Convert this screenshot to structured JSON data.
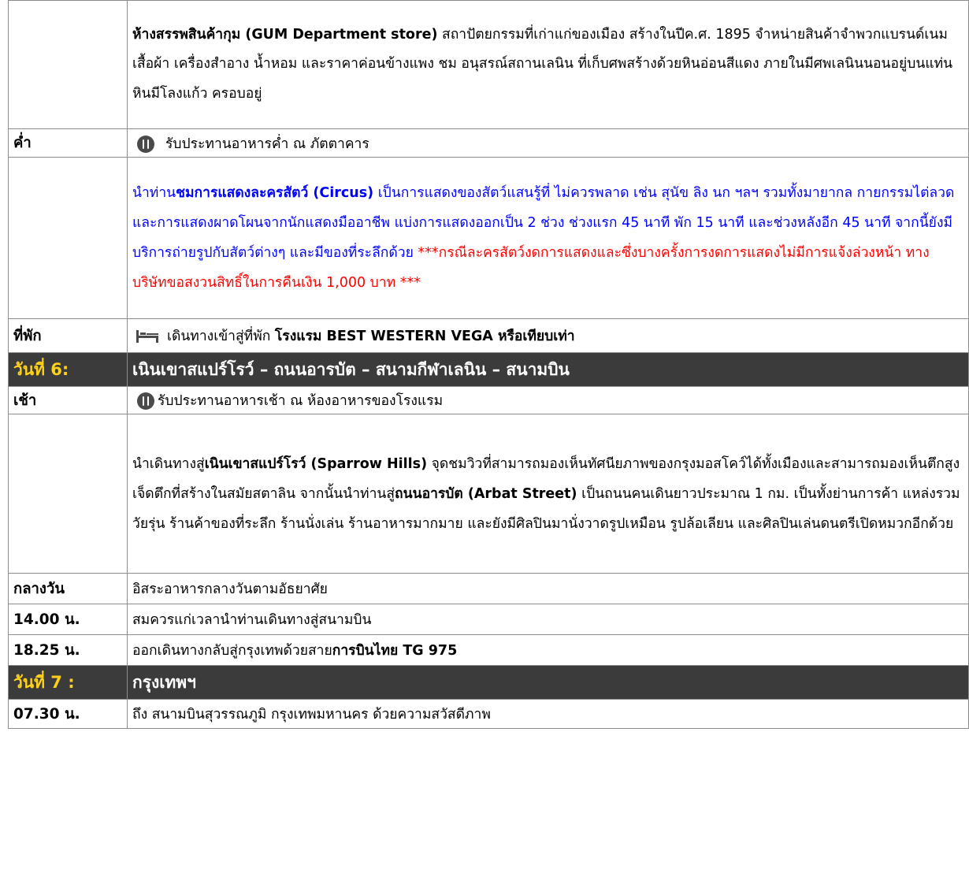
{
  "rows": {
    "gum": {
      "title": "ห้างสรรพสินค้ากุม (GUM Department store)",
      "text": " สถาปัตยกรรมที่เก่าแก่ของเมือง สร้างในปีค.ศ. 1895  จำหน่ายสินค้าจำพวกแบรนด์เนม เสื้อผ้า เครื่องสำอาง น้ำหอม และราคาค่อนข้างแพง ชม อนุสรณ์สถานเลนิน ที่เก็บศพสร้างด้วยหินอ่อนสีแดง ภายในมีศพเลนินนอนอยู่บนแท่นหินมีโลงแก้ว ครอบอยู่"
    },
    "dinner": {
      "label": "ค่ำ",
      "icon": "restaurant-icon",
      "text": "รับประทานอาหารค่ำ ณ ภัตตาคาร"
    },
    "circus": {
      "prefix": "นำท่าน",
      "title": "ชมการแสดงละครสัตว์ (Circus)",
      "text": " เป็นการแสดงของสัตว์แสนรู้ที่ ไม่ควรพลาด เช่น สุนัข ลิง นก ฯลฯ รวมทั้งมายากล กายกรรมไต่ลวด และการแสดงผาดโผนจากนักแสดงมืออาชีพ  แบ่งการแสดงออกเป็น 2 ช่วง ช่วงแรก 45 นาที พัก 15 นาที และช่วงหลังอีก 45 นาที จากนี้ยังมีบริการถ่ายรูปกับสัตว์ต่างๆ และมีของที่ระลึกด้วย ",
      "warning": "***กรณีละครสัตว์งดการแสดงและซึ่งบางครั้งการงดการแสดงไม่มีการแจ้งล่วงหน้า ทางบริษัทขอสงวนสิทธิ์ในการคืนเงิน 1,000 บาท ***"
    },
    "hotel": {
      "label": "ที่พัก",
      "icon": "bed-icon",
      "text": "เดินทางเข้าสู่ที่พัก ",
      "name": "โรงแรม BEST WESTERN VEGA หรือเทียบเท่า"
    },
    "day6": {
      "label": "วันที่ 6:",
      "title": "เนินเขาสแปร์โรว์ – ถนนอารบัต – สนามกีฬาเลนิน –  สนามบิน"
    },
    "breakfast": {
      "label": "เช้า",
      "icon": "restaurant-icon",
      "text": "รับประทานอาหารเช้า ณ ห้องอาหารของโรงแรม"
    },
    "sparrow": {
      "prefix": "นำเดินทางสู่",
      "title1": "เนินเขาสแปร์โรว์ (Sparrow Hills)",
      "text1": " จุดชมวิวที่สามารถมองเห็นทัศนียภาพของกรุงมอสโคว์ได้ทั้งเมืองและสามารถมองเห็นตึกสูงเจ็ดตึกที่สร้างในสมัยสตาลิน จากนั้นนำท่านสู่",
      "title2": "ถนนอารบัต (Arbat Street)",
      "text2": " เป็นถนนคนเดินยาวประมาณ 1 กม. เป็นทั้งย่านการค้า แหล่งรวมวัยรุ่น ร้านค้าของที่ระลึก ร้านนั่งเล่น ร้านอาหารมากมาย และยังมีศิลปินมานั่งวาดรูปเหมือน รูปล้อเลียน และศิลปินเล่นดนตรีเปิดหมวกอีกด้วย"
    },
    "lunch": {
      "label": "กลางวัน",
      "text": "อิสระอาหารกลางวันตามอัธยาศัย"
    },
    "t1400": {
      "label": "14.00 น.",
      "text": "สมควรแก่เวลานำท่านเดินทางสู่สนามบิน"
    },
    "t1825": {
      "label": "18.25 น.",
      "text": "ออกเดินทางกลับสู่กรุงเทพด้วยสาย",
      "airline": "การบินไทย TG 975"
    },
    "day7": {
      "label": "วันที่ 7 :",
      "title": "กรุงเทพฯ"
    },
    "t0730": {
      "label": "07.30 น.",
      "text": "ถึง สนามบินสุวรรณภูมิ กรุงเทพมหานคร ด้วยความสวัสดีภาพ"
    }
  }
}
